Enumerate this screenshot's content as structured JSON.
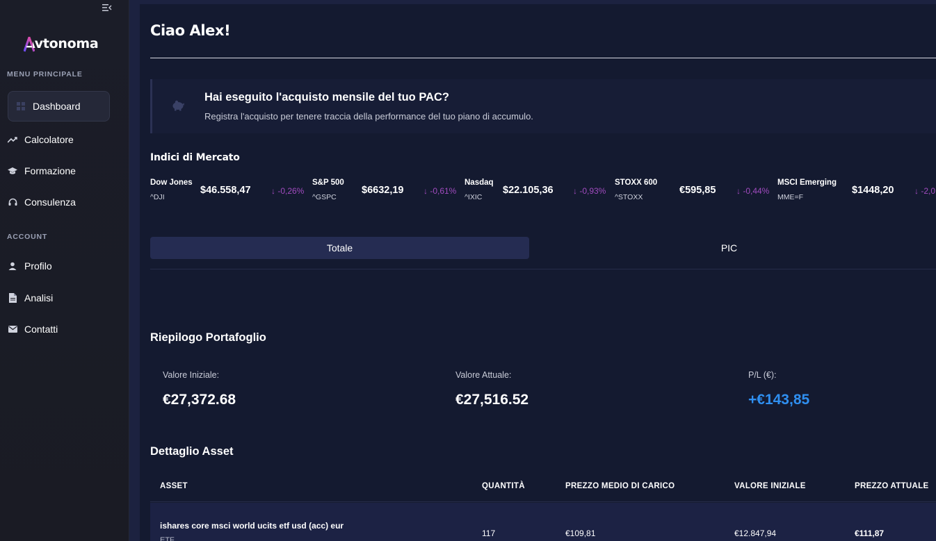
{
  "sidebar": {
    "logo_text": "Avtonoma",
    "menu_title": "MENU PRINCIPALE",
    "account_title": "ACCOUNT",
    "menu_items": [
      {
        "label": "Dashboard",
        "icon": "grid-icon"
      },
      {
        "label": "Calcolatore",
        "icon": "trending-up-icon"
      },
      {
        "label": "Formazione",
        "icon": "graduation-cap-icon"
      },
      {
        "label": "Consulenza",
        "icon": "headset-icon"
      }
    ],
    "account_items": [
      {
        "label": "Profilo",
        "icon": "user-icon"
      },
      {
        "label": "Analisi",
        "icon": "document-icon"
      },
      {
        "label": "Contatti",
        "icon": "mail-icon"
      }
    ]
  },
  "main": {
    "greeting": "Ciao Alex!",
    "pac_card": {
      "title": "Hai eseguito l'acquisto mensile del tuo PAC?",
      "subtitle": "Registra l'acquisto per tenere traccia della performance del tuo piano di accumulo.",
      "icon": "piggy-bank-icon"
    },
    "indices": {
      "title": "Indici di Mercato",
      "items": [
        {
          "name": "Dow Jones",
          "symbol": "^DJI",
          "price": "$46.558,47",
          "change": "↓ -0,26%"
        },
        {
          "name": "S&P 500",
          "symbol": "^GSPC",
          "price": "$6632,19",
          "change": "↓ -0,61%"
        },
        {
          "name": "Nasdaq",
          "symbol": "^IXIC",
          "price": "$22.105,36",
          "change": "↓ -0,93%"
        },
        {
          "name": "STOXX 600",
          "symbol": "^STOXX",
          "price": "€595,85",
          "change": "↓ -0,44%"
        },
        {
          "name": "MSCI Emerging",
          "symbol": "MME=F",
          "price": "$1448,20",
          "change": "↓ -2,0"
        }
      ]
    },
    "tabs": [
      "Totale",
      "PIC"
    ],
    "summary": {
      "title": "Riepilogo Portafoglio",
      "initial_label": "Valore Iniziale:",
      "initial_value": "€27,372.68",
      "current_label": "Valore Attuale:",
      "current_value": "€27,516.52",
      "pl_label": "P/L (€):",
      "pl_value": "+€143,85",
      "pl_color": "#2f8ff0"
    },
    "assets": {
      "title": "Dettaglio Asset",
      "columns": [
        "ASSET",
        "QUANTITÀ",
        "PREZZO MEDIO DI CARICO",
        "VALORE INIZIALE",
        "PREZZO ATTUALE"
      ],
      "rows": [
        {
          "name": "ishares core msci world ucits etf usd (acc) eur",
          "type": "ETF",
          "quantity": "117",
          "avg_price": "€109,81",
          "initial_value": "€12.847,94",
          "current_price": "€111,87"
        }
      ]
    }
  },
  "colors": {
    "accent": "#2f8ff0",
    "negative_change": "#a14bbf",
    "logo_gradient_start": "#6a4dff",
    "logo_gradient_end": "#ff4d8d"
  }
}
